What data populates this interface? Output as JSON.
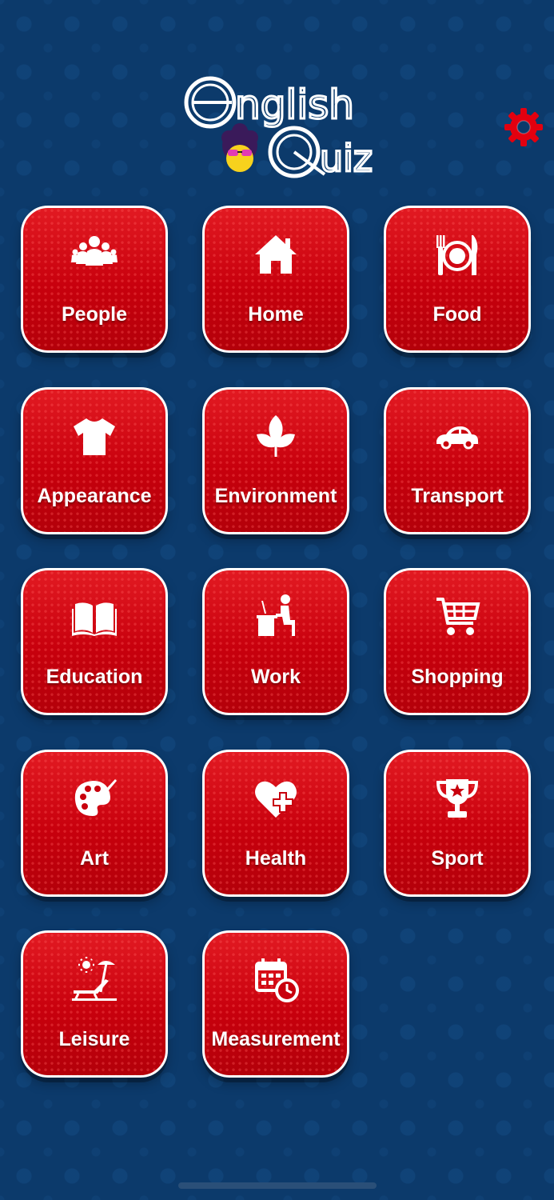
{
  "app": {
    "logo_text_line1": "English",
    "logo_text_line2": "Quiz"
  },
  "categories": [
    {
      "label": "People",
      "icon": "people-icon"
    },
    {
      "label": "Home",
      "icon": "house-icon"
    },
    {
      "label": "Food",
      "icon": "plate-cutlery-icon"
    },
    {
      "label": "Appearance",
      "icon": "tshirt-icon"
    },
    {
      "label": "Environment",
      "icon": "leaves-icon"
    },
    {
      "label": "Transport",
      "icon": "car-icon"
    },
    {
      "label": "Education",
      "icon": "open-book-icon"
    },
    {
      "label": "Work",
      "icon": "desk-worker-icon"
    },
    {
      "label": "Shopping",
      "icon": "shopping-cart-icon"
    },
    {
      "label": "Art",
      "icon": "palette-icon"
    },
    {
      "label": "Health",
      "icon": "heart-plus-icon"
    },
    {
      "label": "Sport",
      "icon": "trophy-icon"
    },
    {
      "label": "Leisure",
      "icon": "beach-chair-icon"
    },
    {
      "label": "Measurement",
      "icon": "calendar-clock-icon"
    }
  ],
  "colors": {
    "background": "#0c3a6b",
    "tile": "#d50a15",
    "tile_border": "#ffffff",
    "settings": "#e3000f"
  },
  "settings_icon": "gear-icon"
}
